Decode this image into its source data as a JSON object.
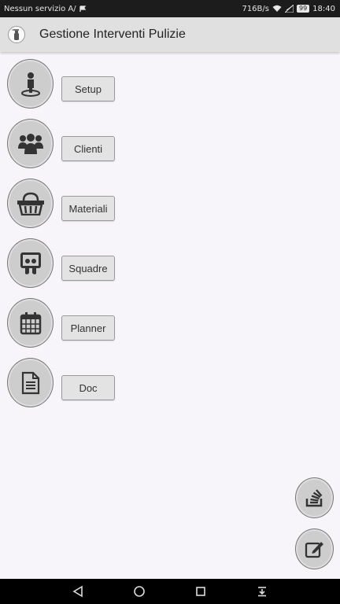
{
  "status_bar": {
    "carrier": "Nessun servizio A/",
    "speed": "716B/s",
    "battery": "99",
    "time": "18:40"
  },
  "app_bar": {
    "title": "Gestione Interventi Pulizie",
    "logo_icon": "spray-bottle-icon"
  },
  "menu": {
    "items": [
      {
        "label": "Setup",
        "icon": "person-standing-icon"
      },
      {
        "label": "Clienti",
        "icon": "users-group-icon"
      },
      {
        "label": "Materiali",
        "icon": "basket-icon"
      },
      {
        "label": "Squadre",
        "icon": "team-badge-icon"
      },
      {
        "label": "Planner",
        "icon": "calendar-icon"
      },
      {
        "label": "Doc",
        "icon": "document-icon"
      }
    ]
  },
  "fabs": {
    "stack_icon": "stack-icon",
    "edit_icon": "edit-icon"
  },
  "nav_bar": {
    "back_icon": "back-triangle-icon",
    "home_icon": "home-circle-icon",
    "recents_icon": "recents-square-icon",
    "notifications_icon": "pull-down-icon"
  },
  "colors": {
    "status_bar_bg": "#1c1c1c",
    "app_bar_bg": "#e0e0e0",
    "page_bg": "#f7f5fa",
    "button_bg": "#e3e3e3",
    "icon_button_bg": "#cdcdcd",
    "nav_bar_bg": "#000000"
  }
}
